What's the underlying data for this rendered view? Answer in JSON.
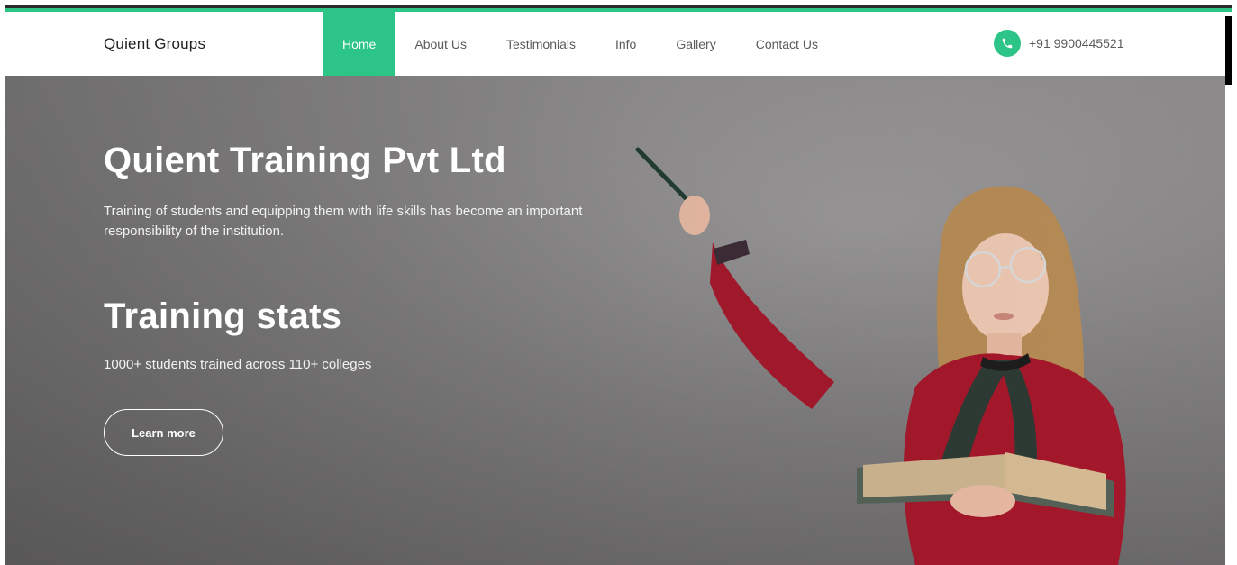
{
  "brand": {
    "name": "Quient Groups"
  },
  "nav": {
    "items": [
      {
        "label": "Home",
        "active": true
      },
      {
        "label": "About Us",
        "active": false
      },
      {
        "label": "Testimonials",
        "active": false
      },
      {
        "label": "Info",
        "active": false
      },
      {
        "label": "Gallery",
        "active": false
      },
      {
        "label": "Contact Us",
        "active": false
      }
    ]
  },
  "contact": {
    "phone": "+91 9900445521",
    "icon": "phone-icon"
  },
  "hero": {
    "title": "Quient Training Pvt Ltd",
    "description": "Training of students and equipping them with life skills has become an important responsibility of the institution.",
    "stats_title": "Training stats",
    "stats_text": "1000+ students trained across 110+ colleges",
    "cta_label": "Learn more"
  },
  "colors": {
    "accent": "#2cc487",
    "text_dark": "#222222",
    "text_muted": "#5a5a5a",
    "hero_bg": "#868485"
  }
}
